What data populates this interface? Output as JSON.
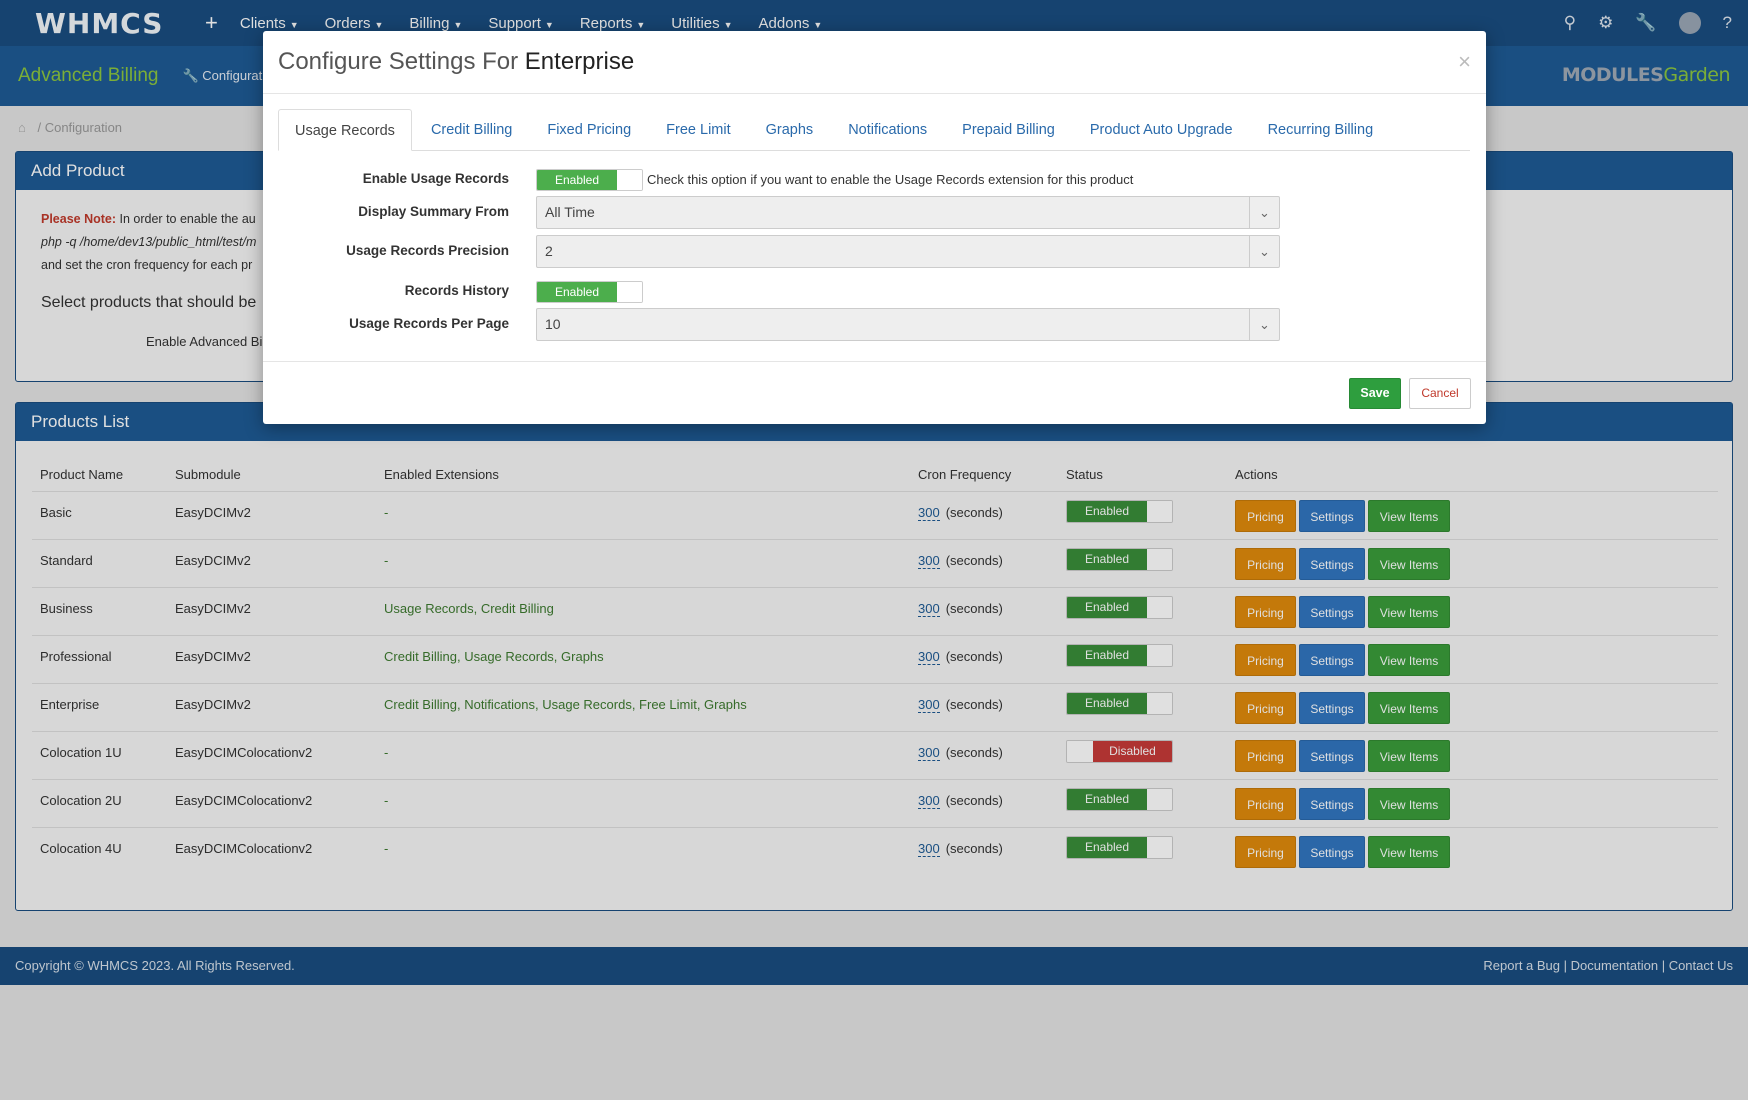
{
  "topnav": {
    "logo": "WHMCS",
    "plus": "+",
    "menu": [
      "Clients",
      "Orders",
      "Billing",
      "Support",
      "Reports",
      "Utilities",
      "Addons"
    ]
  },
  "subheader": {
    "title": "Advanced Billing",
    "configuration": "Configurat",
    "brand": "MODULES",
    "brand_suffix": "Garden"
  },
  "breadcrumb": {
    "item": "Configuration"
  },
  "add_product": {
    "title": "Add Product",
    "note_label": "Please Note:",
    "note_text": "In order to enable the au",
    "command": "php -q /home/dev13/public_html/test/m",
    "cron_text": "and set the cron frequency for each pr",
    "select_text": "Select products that should be",
    "enable_label": "Enable Advanced Bi"
  },
  "products": {
    "title": "Products List",
    "columns": [
      "Product Name",
      "Submodule",
      "Enabled Extensions",
      "Cron Frequency",
      "Status",
      "Actions"
    ],
    "seconds_label": "(seconds)",
    "buttons": {
      "pricing": "Pricing",
      "settings": "Settings",
      "view": "View Items"
    },
    "rows": [
      {
        "name": "Basic",
        "submodule": "EasyDCIMv2",
        "extensions": "-",
        "cron": "300",
        "status": "Enabled"
      },
      {
        "name": "Standard",
        "submodule": "EasyDCIMv2",
        "extensions": "-",
        "cron": "300",
        "status": "Enabled"
      },
      {
        "name": "Business",
        "submodule": "EasyDCIMv2",
        "extensions": "Usage Records, Credit Billing",
        "cron": "300",
        "status": "Enabled"
      },
      {
        "name": "Professional",
        "submodule": "EasyDCIMv2",
        "extensions": "Credit Billing, Usage Records, Graphs",
        "cron": "300",
        "status": "Enabled"
      },
      {
        "name": "Enterprise",
        "submodule": "EasyDCIMv2",
        "extensions": "Credit Billing, Notifications, Usage Records, Free Limit, Graphs",
        "cron": "300",
        "status": "Enabled"
      },
      {
        "name": "Colocation 1U",
        "submodule": "EasyDCIMColocationv2",
        "extensions": "-",
        "cron": "300",
        "status": "Disabled"
      },
      {
        "name": "Colocation 2U",
        "submodule": "EasyDCIMColocationv2",
        "extensions": "-",
        "cron": "300",
        "status": "Enabled"
      },
      {
        "name": "Colocation 4U",
        "submodule": "EasyDCIMColocationv2",
        "extensions": "-",
        "cron": "300",
        "status": "Enabled"
      }
    ]
  },
  "footer": {
    "copyright": "Copyright © WHMCS 2023. All Rights Reserved.",
    "links": [
      "Report a Bug",
      "Documentation",
      "Contact Us"
    ]
  },
  "modal": {
    "title_prefix": "Configure Settings For",
    "title_product": "Enterprise",
    "close": "×",
    "tabs": [
      "Usage Records",
      "Credit Billing",
      "Fixed Pricing",
      "Free Limit",
      "Graphs",
      "Notifications",
      "Prepaid Billing",
      "Product Auto Upgrade",
      "Recurring Billing"
    ],
    "active_tab": "Usage Records",
    "fields": {
      "enable_usage": {
        "label": "Enable Usage Records",
        "toggle": "Enabled",
        "help": "Check this option if you want to enable the Usage Records extension for this product"
      },
      "display_summary": {
        "label": "Display Summary From",
        "value": "All Time"
      },
      "precision": {
        "label": "Usage Records Precision",
        "value": "2"
      },
      "history": {
        "label": "Records History",
        "toggle": "Enabled"
      },
      "per_page": {
        "label": "Usage Records Per Page",
        "value": "10"
      }
    },
    "save": "Save",
    "cancel": "Cancel"
  }
}
